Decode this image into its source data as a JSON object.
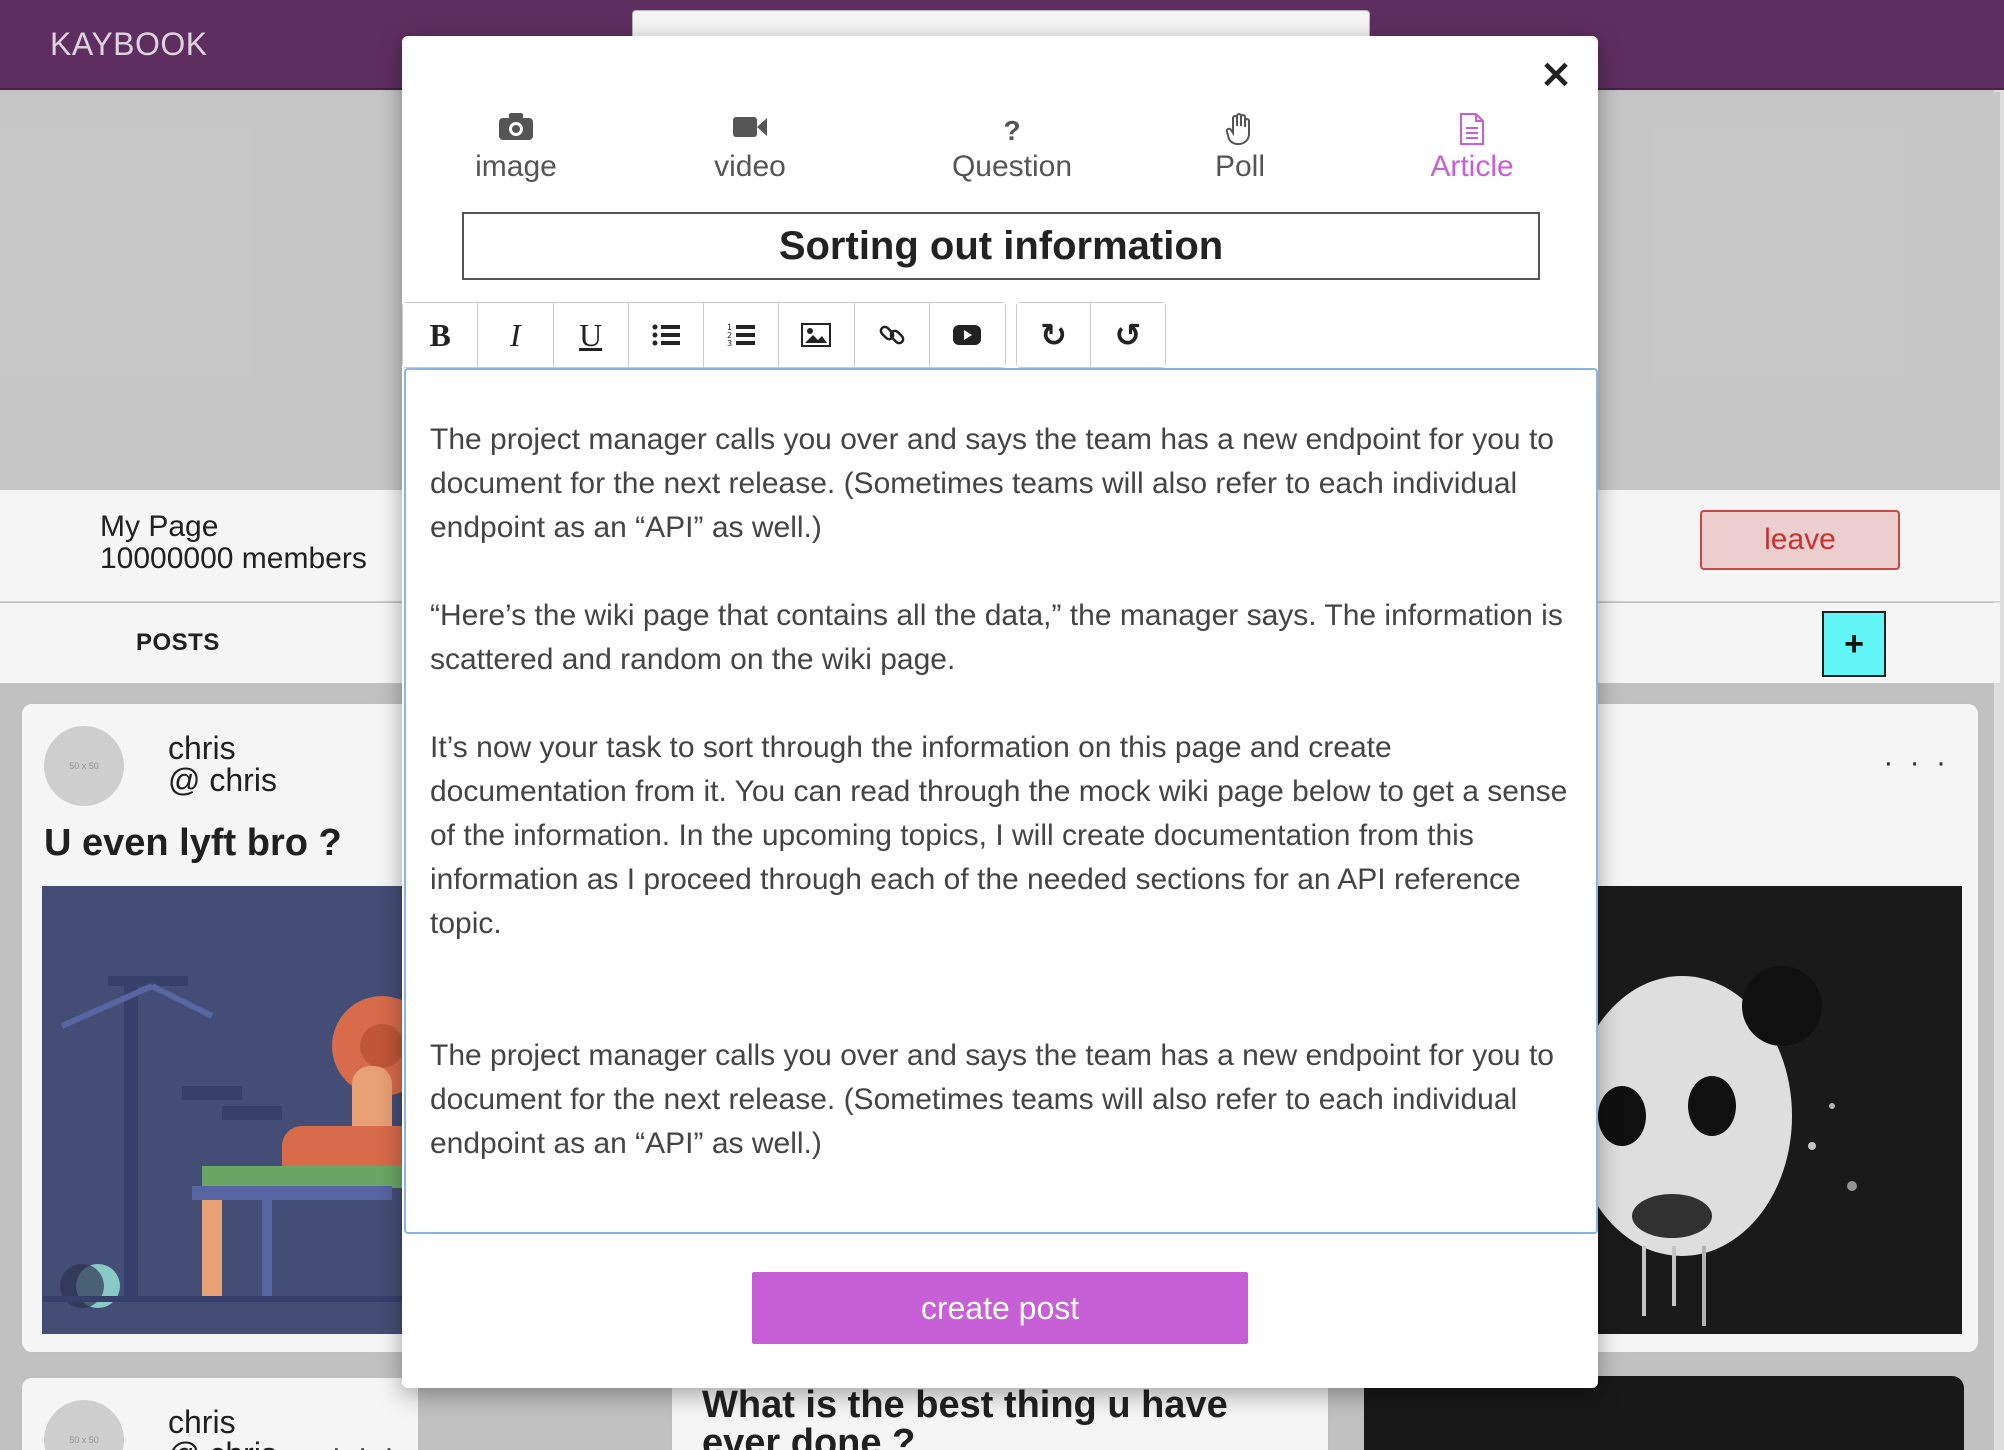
{
  "app": {
    "brand": "KAYBOOK"
  },
  "group": {
    "name": "My Page",
    "members": "10000000 members",
    "leave_label": "leave"
  },
  "tabs": {
    "posts_label": "POSTS",
    "add_label": "+"
  },
  "cards": [
    {
      "avatar_text": "50 x 50",
      "author_name": "chris",
      "author_handle": "@ chris",
      "title": "U even lyft bro ?"
    },
    {
      "menu": "· · ·"
    },
    {
      "avatar_text": "50 x 50",
      "author_name": "chris",
      "author_handle": "@ chris",
      "menu": "· · ·"
    },
    {
      "title": "What is the best thing u have ever done ?"
    }
  ],
  "modal": {
    "close_icon": "×",
    "post_types": [
      {
        "label": "image",
        "icon": "camera-icon",
        "glyph": "📷"
      },
      {
        "label": "video",
        "icon": "video-camera-icon",
        "glyph": "■"
      },
      {
        "label": "Question",
        "icon": "question-icon",
        "glyph": "?"
      },
      {
        "label": "Poll",
        "icon": "hand-icon",
        "glyph": "✋"
      },
      {
        "label": "Article",
        "icon": "document-icon",
        "glyph": "▤",
        "active": true
      }
    ],
    "accent_color": "#c75fd6",
    "title_value": "Sorting out information",
    "toolbar": {
      "bold": "B",
      "italic": "I",
      "underline": "U",
      "bullet_list": "☰",
      "numbered_list": "☷",
      "image": "▣",
      "link": "∞",
      "youtube": "▶",
      "redo": "↻",
      "undo": "↺"
    },
    "body_paragraphs": [
      "The project manager calls you over and says the team has a new endpoint for you to document for the next release. (Sometimes teams will also refer to each individual endpoint as an “API” as well.)",
      "“Here’s the wiki page that contains all the data,” the manager says. The information is scattered and random on the wiki page.",
      "It’s now your task to sort through the information on this page and create documentation from it. You can read through the mock wiki page below to get a sense of the information. In the upcoming topics, I will create documentation from this information as I proceed through each of the needed sections for an API reference topic.",
      "The project manager calls you over and says the team has a new endpoint for you to document for the next release. (Sometimes teams will also refer to each individual endpoint as an “API” as well.)"
    ],
    "submit_label": "create post"
  }
}
